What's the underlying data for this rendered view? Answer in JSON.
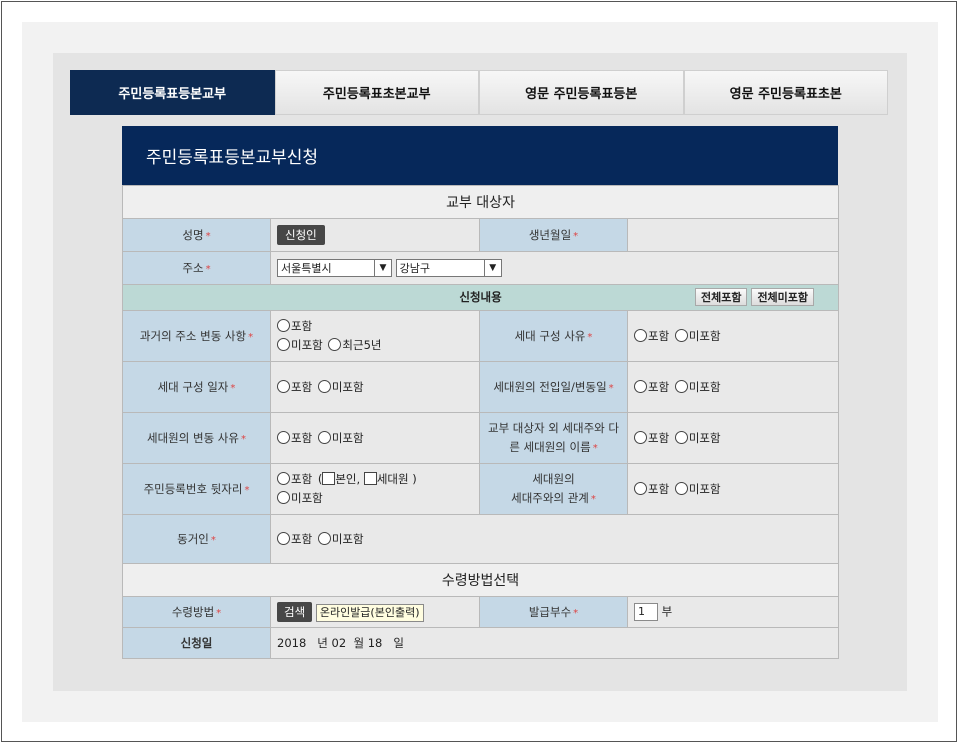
{
  "tabs": [
    "주민등록표등본교부",
    "주민등록표초본교부",
    "영문 주민등록표등본",
    "영문 주민등록표초본"
  ],
  "form_title": "주민등록표등본교부신청",
  "section_target": "교부 대상자",
  "fields": {
    "name_label": "성명",
    "name_button": "신청인",
    "birth_label": "생년월일",
    "address_label": "주소",
    "city_value": "서울특별시",
    "district_value": "강남구"
  },
  "required_mark": "*",
  "content": {
    "title": "신청내용",
    "btn_include_all": "전체포함",
    "btn_exclude_all": "전체미포함"
  },
  "opt": {
    "include": "포함",
    "exclude": "미포함",
    "recent5": "최근5년",
    "self": "본인,",
    "member": "세대원 )"
  },
  "rows": {
    "past_address": "과거의 주소 변동 사항",
    "household_reason": "세대 구성 사유",
    "household_date": "세대 구성 일자",
    "member_move_date": "세대원의 전입일/변동일",
    "member_change_reason": "세대원의 변동 사유",
    "other_head_names_1": "교부 대상자 외 세대주와 다",
    "other_head_names_2": "른 세대원의 이름",
    "id_back_digits": "주민등록번호 뒷자리",
    "relation_1": "세대원의",
    "relation_2": "세대주와의 관계",
    "cohabitant": "동거인"
  },
  "section_receive": "수령방법선택",
  "receive": {
    "method_label": "수령방법",
    "search_button": "검색",
    "method_value": "온라인발급(본인출력)",
    "copies_label": "발급부수",
    "copies_value": "1",
    "copies_unit": "부"
  },
  "apply_date": {
    "label": "신청일",
    "year": "2018",
    "year_unit": "년",
    "month": "02",
    "month_unit": "월",
    "day": "18",
    "day_unit": "일"
  }
}
